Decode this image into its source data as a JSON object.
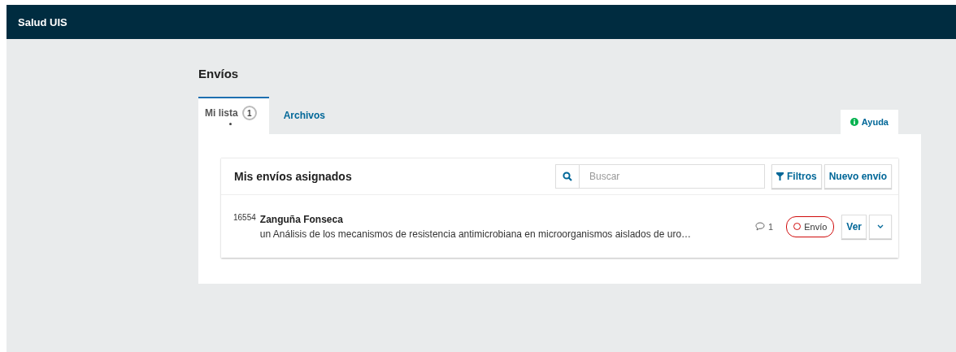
{
  "header": {
    "title": "Salud UIS"
  },
  "page_title": "Envíos",
  "tabs": [
    {
      "label": "Mi lista",
      "badge": "1",
      "unread": true,
      "selected": true
    },
    {
      "label": "Archivos",
      "selected": false
    }
  ],
  "help": {
    "label": "Ayuda"
  },
  "list": {
    "title": "Mis envíos asignados",
    "search": {
      "placeholder": "Buscar"
    },
    "buttons": [
      {
        "kind": "filter",
        "label": "Filtros"
      },
      {
        "kind": "plain",
        "label": "Nuevo envío"
      }
    ],
    "items": [
      {
        "id": "16554",
        "author": "Zanguña Fonseca",
        "title": "un Análisis de los mecanismos de resistencia antimicrobiana en microorganismos aislados de uro…",
        "comments": "1",
        "stage": "Envío",
        "action": "Ver"
      }
    ]
  }
}
